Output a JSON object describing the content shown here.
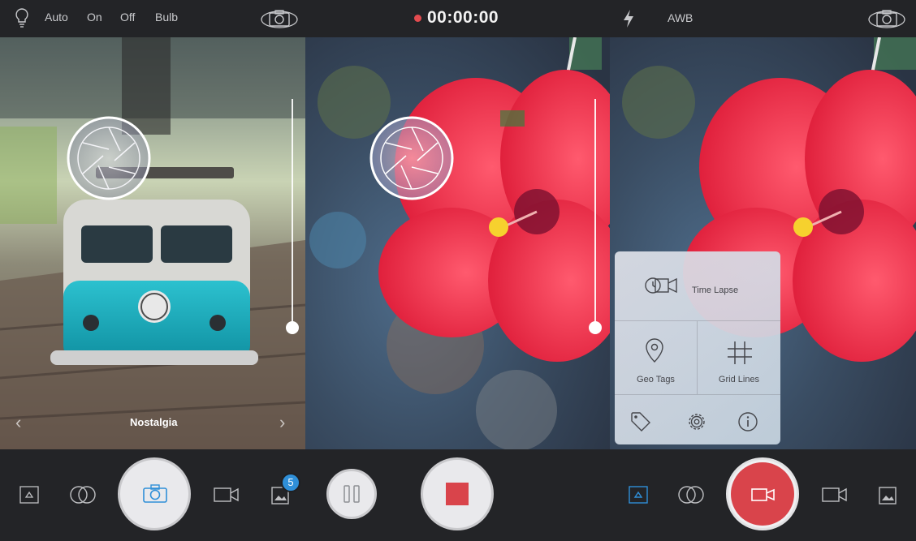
{
  "screen1": {
    "flash_modes": [
      "Auto",
      "On",
      "Off",
      "Bulb"
    ],
    "filter_name": "Nostalgia",
    "gallery_count": "5"
  },
  "screen2": {
    "timer": "00:00:00"
  },
  "screen3": {
    "white_balance": "AWB",
    "menu": {
      "time_lapse": "Time Lapse",
      "geo_tags": "Geo Tags",
      "grid_lines": "Grid Lines"
    }
  },
  "colors": {
    "accent_blue": "#2f8fd8",
    "record_red": "#d9444b",
    "bar_bg": "#232427"
  },
  "icons": [
    "bulb-icon",
    "camera-switch-icon",
    "aperture-icon",
    "lightning-icon",
    "triangle-icon",
    "filters-icon",
    "camera-icon",
    "video-icon",
    "gallery-icon",
    "pause-icon",
    "stop-icon",
    "tag-icon",
    "gear-icon",
    "info-icon",
    "location-pin-icon",
    "grid-icon",
    "timelapse-icon"
  ]
}
